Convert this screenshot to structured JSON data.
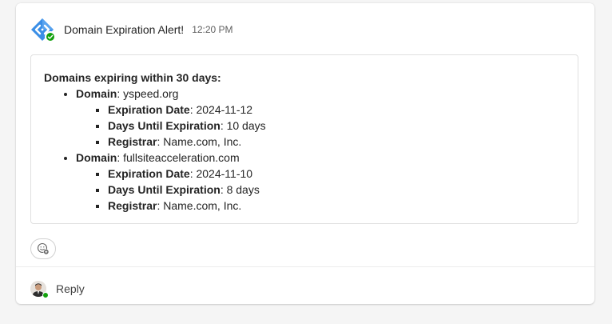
{
  "card": {
    "title": "Domain Expiration Alert!",
    "time": "12:20 PM",
    "app_icon": "azure-diamond-app-icon",
    "presence": "available"
  },
  "message": {
    "heading": "Domains expiring within 30 days:",
    "labels": {
      "domain": "Domain",
      "expiration_date": "Expiration Date",
      "days_until": "Days Until Expiration",
      "registrar": "Registrar"
    },
    "domains": [
      {
        "domain": "yspeed.org",
        "expiration_date": "2024-11-12",
        "days_until": "10 days",
        "registrar": "Name.com, Inc."
      },
      {
        "domain": "fullsiteacceleration.com",
        "expiration_date": "2024-11-10",
        "days_until": "8 days",
        "registrar": "Name.com, Inc."
      }
    ]
  },
  "reactions": {
    "icon": "add-reaction-icon"
  },
  "reply": {
    "label": "Reply",
    "avatar_icon": "user-avatar-icon"
  },
  "colors": {
    "accent_blue": "#3a8ee6",
    "presence_green": "#13a10e",
    "text_primary": "#242424",
    "text_secondary": "#616161",
    "border": "#e0e0e0",
    "page_bg": "#f5f5f5"
  }
}
